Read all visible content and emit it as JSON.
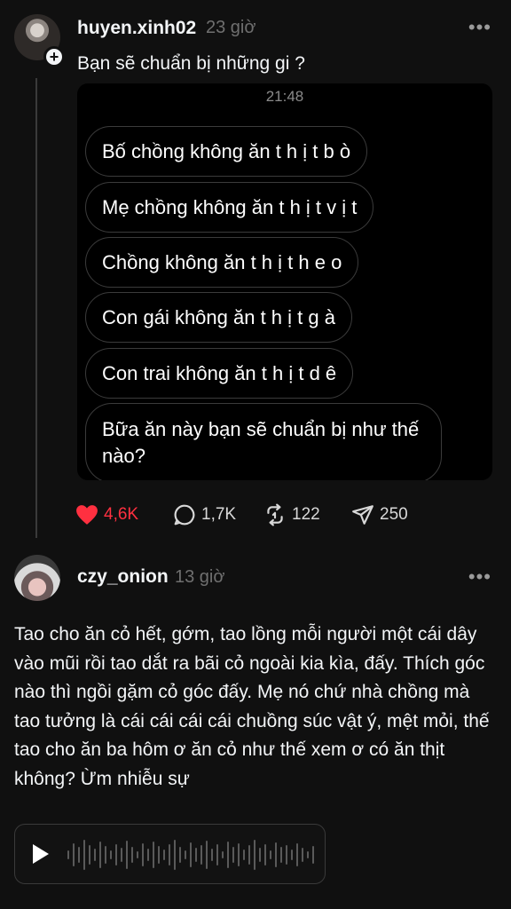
{
  "post": {
    "username": "huyen.xinh02",
    "time": "23 giờ",
    "caption": "Bạn sẽ chuẩn bị những gi ?",
    "embed": {
      "time": "21:48",
      "bubbles": [
        "Bố chồng không ăn t h ị t b ò",
        "Mẹ chồng không ăn t h ị t v ị t",
        "Chồng không ăn t h ị t h e o",
        "Con gái không ăn t h ị t g à",
        "Con trai không ăn t h ị t d ê",
        "Bữa ăn này bạn sẽ chuẩn bị như thế nào?"
      ]
    },
    "actions": {
      "likes": "4,6K",
      "comments": "1,7K",
      "reposts": "122",
      "shares": "250"
    },
    "colors": {
      "like": "#ff3040",
      "background": "#101010"
    },
    "icons": [
      "plus-icon",
      "more-icon",
      "heart-icon",
      "comment-icon",
      "repost-icon",
      "share-icon"
    ]
  },
  "comment": {
    "username": "czy_onion",
    "time": "13 giờ",
    "text": "Tao cho ăn cỏ hết, gớm, tao lồng mỗi người một cái dây vào mũi rồi tao dắt ra bãi cỏ ngoài kia kìa, đấy. Thích góc nào thì ngồi gặm cỏ góc đấy. Mẹ nó chứ nhà chồng mà tao tưởng là cái cái cái cái chuồng súc vật ý, mệt mỏi, thế tao cho ăn ba hôm ơ ăn cỏ như thế xem ơ có ăn thịt không? Ừm nhiễu sự",
    "icons": [
      "more-icon",
      "play-icon",
      "waveform-icon"
    ]
  }
}
